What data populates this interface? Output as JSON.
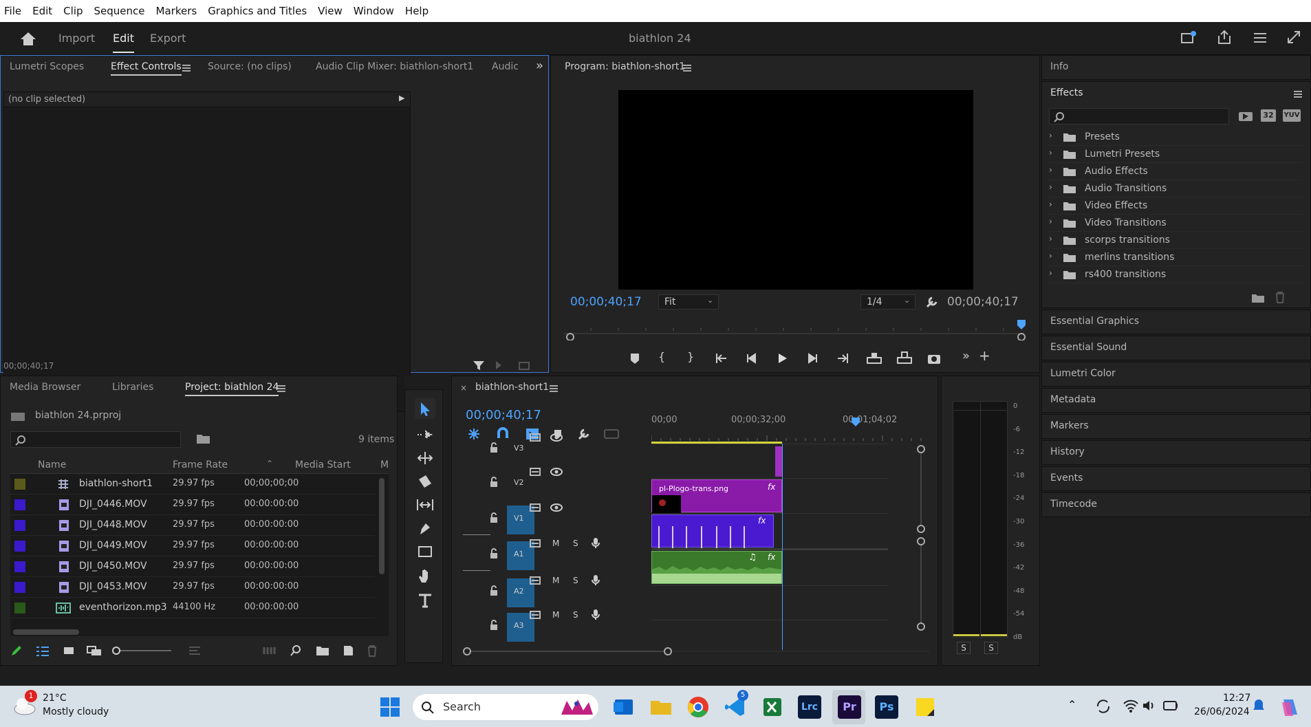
{
  "menu": [
    "File",
    "Edit",
    "Clip",
    "Sequence",
    "Markers",
    "Graphics and Titles",
    "View",
    "Window",
    "Help"
  ],
  "workspace": {
    "import": "Import",
    "edit": "Edit",
    "export": "Export",
    "project_title": "biathlon 24"
  },
  "source_panel": {
    "tabs": [
      "Lumetri Scopes",
      "Effect Controls",
      "Source: (no clips)",
      "Audio Clip Mixer: biathlon-short1",
      "Audic"
    ],
    "no_clip": "(no clip selected)",
    "timecode": "00;00;40;17"
  },
  "program_panel": {
    "title": "Program: biathlon-short1",
    "timecode_left": "00;00;40;17",
    "fit": "Fit",
    "resolution": "1/4",
    "timecode_right": "00;00;40;17"
  },
  "right_panel": {
    "info": "Info",
    "effects": "Effects",
    "effects_items": [
      "Presets",
      "Lumetri Presets",
      "Audio Effects",
      "Audio Transitions",
      "Video Effects",
      "Video Transitions",
      "scorps transitions",
      "merlins transitions",
      "rs400 transitions"
    ],
    "icon_labels": [
      "32",
      "YUV"
    ],
    "sections": [
      "Essential Graphics",
      "Essential Sound",
      "Lumetri Color",
      "Metadata",
      "Markers",
      "History",
      "Events",
      "Timecode"
    ]
  },
  "project_panel": {
    "tabs": [
      "Media Browser",
      "Libraries",
      "Project: biathlon 24"
    ],
    "file": "biathlon 24.prproj",
    "items_count": "9 items",
    "columns": [
      "Name",
      "Frame Rate",
      "Media Start",
      "M"
    ],
    "rows": [
      {
        "color": "#5a5a1a",
        "name": "biathlon-short1",
        "rate": "29.97 fps",
        "start": "00;00;00;00"
      },
      {
        "color": "#3a1acc",
        "name": "DJI_0446.MOV",
        "rate": "29.97 fps",
        "start": "00:00:00:00"
      },
      {
        "color": "#3a1acc",
        "name": "DJI_0448.MOV",
        "rate": "29.97 fps",
        "start": "00:00:00:00"
      },
      {
        "color": "#3a1acc",
        "name": "DJI_0449.MOV",
        "rate": "29.97 fps",
        "start": "00:00:00:00"
      },
      {
        "color": "#3a1acc",
        "name": "DJI_0450.MOV",
        "rate": "29.97 fps",
        "start": "00:00:00:00"
      },
      {
        "color": "#3a1acc",
        "name": "DJI_0453.MOV",
        "rate": "29.97 fps",
        "start": "00:00:00:00"
      },
      {
        "color": "#2a5a1a",
        "name": "eventhorizon.mp3",
        "rate": "44100 Hz",
        "start": "00:00:00:00"
      }
    ]
  },
  "timeline": {
    "title": "biathlon-short1",
    "timecode": "00;00;40;17",
    "ruler": [
      "00;00",
      "00;00;32;00",
      "00;01;04;02"
    ],
    "tracks": [
      "V3",
      "V2",
      "V1",
      "A1",
      "A2",
      "A3"
    ],
    "clip_v2": "pl-Plogo-trans.png",
    "fx": "fx",
    "mute": "M",
    "solo": "S"
  },
  "meter": {
    "labels": [
      "0",
      "-6",
      "-12",
      "-18",
      "-24",
      "-30",
      "-36",
      "-42",
      "-48",
      "-54",
      "dB"
    ],
    "solo": [
      "S",
      "S"
    ]
  },
  "taskbar": {
    "temp": "21°C",
    "weather": "Mostly cloudy",
    "weather_badge": "1",
    "search": "Search",
    "time": "12:27",
    "date": "26/06/2024",
    "steam_badge": "5",
    "lrc": "Lrc",
    "pr": "Pr",
    "ps": "Ps"
  }
}
